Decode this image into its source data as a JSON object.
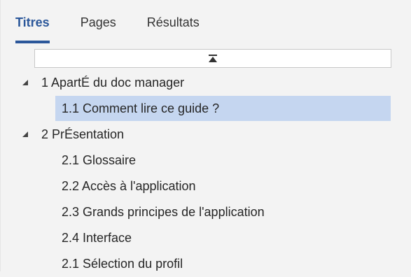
{
  "tabs": [
    {
      "label": "Titres",
      "active": true
    },
    {
      "label": "Pages",
      "active": false
    },
    {
      "label": "Résultats",
      "active": false
    }
  ],
  "collapse_icon": "collapse-all-icon",
  "tree": [
    {
      "label": "1 ApartÉ du doc manager",
      "level": 1,
      "expanded": true
    },
    {
      "label": "1.1 Comment lire ce guide ?",
      "level": 2,
      "selected": true
    },
    {
      "label": "2 PrÉsentation",
      "level": 1,
      "expanded": true
    },
    {
      "label": "2.1 Glossaire",
      "level": 2
    },
    {
      "label": "2.2 Accès à l'application",
      "level": 2
    },
    {
      "label": "2.3 Grands principes de l'application",
      "level": 2
    },
    {
      "label": "2.4 Interface",
      "level": 2
    },
    {
      "label": "2.1 Sélection du profil",
      "level": 2
    }
  ],
  "colors": {
    "accent": "#2b579a",
    "selection": "#c5d6f0",
    "background": "#f3f3f3"
  }
}
